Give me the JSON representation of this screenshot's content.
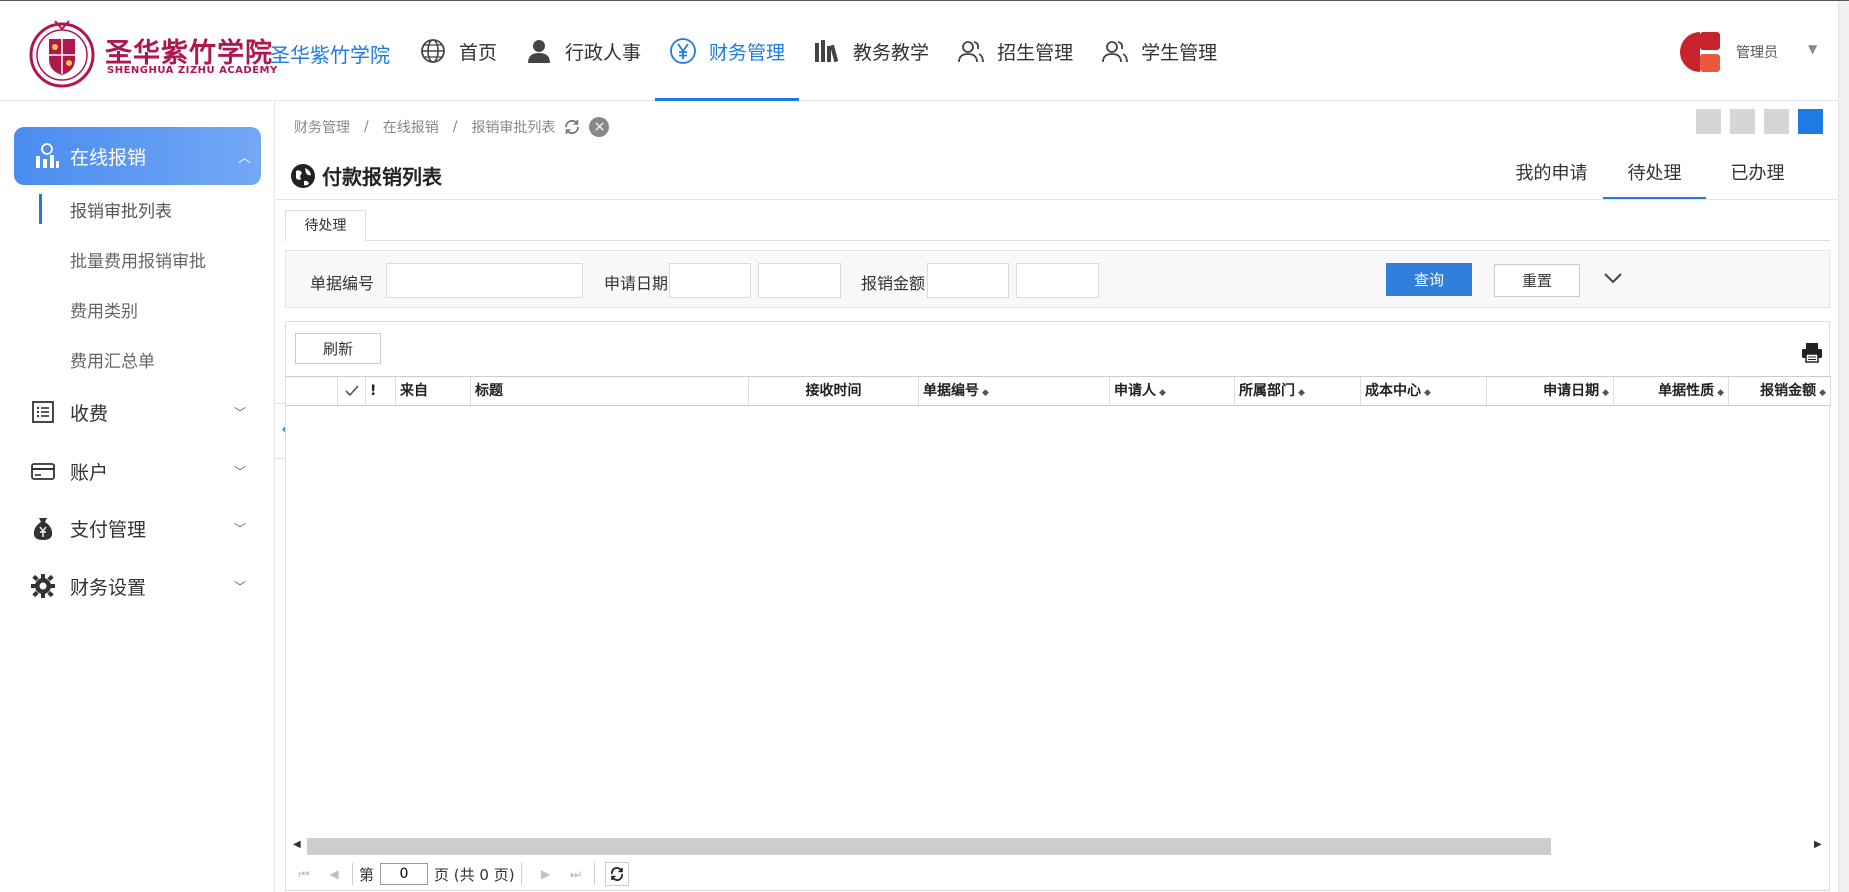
{
  "header": {
    "logo_cn": "圣华紫竹学院",
    "logo_en": "SHENGHUA ZIZHU ACADEMY",
    "site_name": "圣华紫竹学院",
    "nav": [
      {
        "label": "首页",
        "icon": "globe-icon"
      },
      {
        "label": "行政人事",
        "icon": "user-icon"
      },
      {
        "label": "财务管理",
        "icon": "yen-icon",
        "active": true
      },
      {
        "label": "教务教学",
        "icon": "books-icon"
      },
      {
        "label": "招生管理",
        "icon": "users-icon"
      },
      {
        "label": "学生管理",
        "icon": "users-icon"
      }
    ],
    "user_name": "管理员",
    "accent": "#1e7be6"
  },
  "breadcrumb": [
    "财务管理",
    "在线报销",
    "报销审批列表"
  ],
  "sidebar": {
    "active_group": "在线报销",
    "sub_items": [
      "报销审批列表",
      "批量费用报销审批",
      "费用类别",
      "费用汇总单"
    ],
    "groups": [
      "收费",
      "账户",
      "支付管理",
      "财务设置"
    ]
  },
  "page": {
    "title": "付款报销列表",
    "tabs": [
      "我的申请",
      "待处理",
      "已办理"
    ],
    "active_tab": "待处理",
    "sub_tab": "待处理"
  },
  "search": {
    "doc_no_label": "单据编号",
    "doc_no_value": "",
    "apply_date_label": "申请日期",
    "amount_label": "报销金额",
    "query_btn": "查询",
    "reset_btn": "重置"
  },
  "grid": {
    "refresh_btn": "刷新",
    "columns": [
      "!",
      "来自",
      "标题",
      "接收时间",
      "单据编号",
      "申请人",
      "所属部门",
      "成本中心",
      "申请日期",
      "单据性质",
      "报销金额"
    ],
    "rows": []
  },
  "pager": {
    "prefix": "第",
    "page": "0",
    "suffix": "页 (共 0 页)"
  }
}
